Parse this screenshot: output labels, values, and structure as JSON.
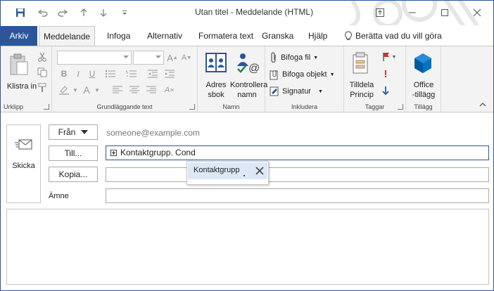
{
  "window": {
    "title": "Utan titel  -  Meddelande (HTML)"
  },
  "tabs": [
    {
      "label": "Arkiv"
    },
    {
      "label": "Meddelande"
    },
    {
      "label": "Infoga"
    },
    {
      "label": "Alternativ"
    },
    {
      "label": "Formatera text"
    },
    {
      "label": "Granska"
    },
    {
      "label": "Hjälp"
    }
  ],
  "tell_me": "Berätta vad du vill göra",
  "ribbon": {
    "clipboard": {
      "paste_label": "Klistra in",
      "group_label": "Urklipp"
    },
    "basic_text": {
      "group_label": "Grundläggande text"
    },
    "names": {
      "address_book": [
        "Adres",
        "sbok"
      ],
      "check_names": [
        "Kontrollera",
        "namn"
      ],
      "group_label": "Namn"
    },
    "include": {
      "attach_file": "Bifoga fil",
      "attach_item": "Bifoga objekt",
      "signature": "Signatur",
      "group_label": "Inkludera"
    },
    "tags": {
      "assign_policy": [
        "Tilldela",
        "Princip"
      ],
      "group_label": "Taggar"
    },
    "addins": {
      "office_addins": [
        "Office",
        "-tillägg"
      ],
      "group_label": "Tillägg"
    }
  },
  "compose": {
    "send_label": "Skicka",
    "from_label": "Från",
    "from_address": "someone@example.com",
    "to_label": "Till...",
    "to_value": "Kontaktgrupp. Cond",
    "cc_label": "Kopia...",
    "subject_label": "Ämne",
    "autocomplete_item": "Kontaktgrupp"
  },
  "colors": {
    "accent": "#2b579a",
    "ribbon_bg": "#f3f3f3",
    "flag_red": "#c0392b",
    "addin_blue": "#0072c6"
  }
}
